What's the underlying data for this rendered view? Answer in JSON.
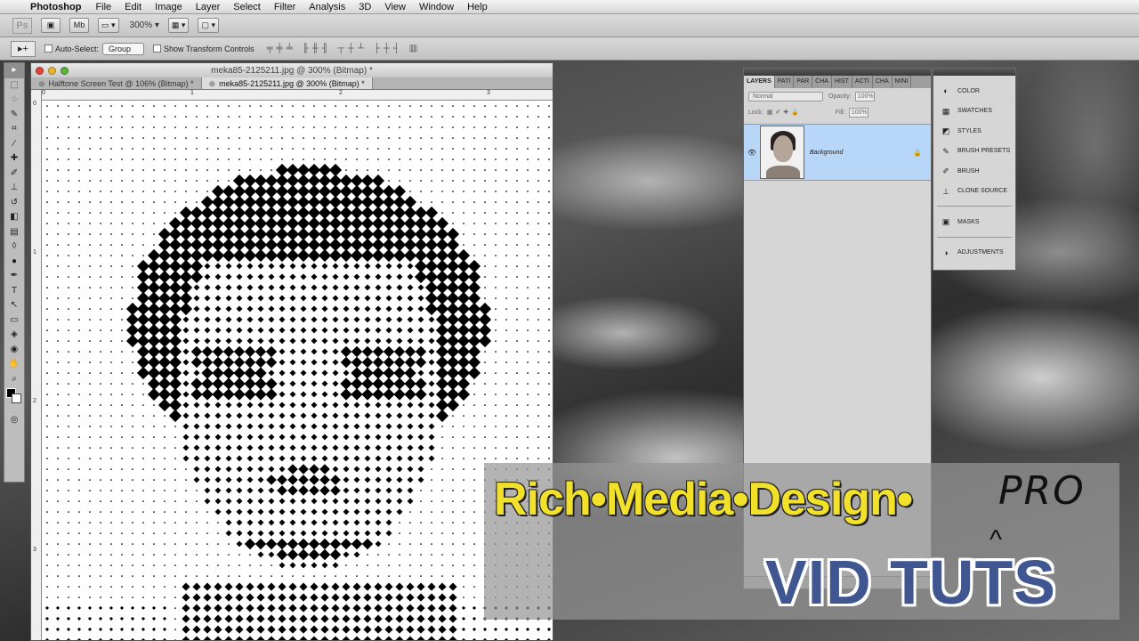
{
  "menubar": {
    "app_name": "Photoshop",
    "menus": [
      "File",
      "Edit",
      "Image",
      "Layer",
      "Select",
      "Filter",
      "Analysis",
      "3D",
      "View",
      "Window",
      "Help"
    ]
  },
  "appbar": {
    "logo": "Ps",
    "zoom": "300%"
  },
  "optionsbar": {
    "auto_select_label": "Auto-Select:",
    "auto_select_value": "Group",
    "transform_label": "Show Transform Controls"
  },
  "document": {
    "title": "meka85-2125211.jpg @ 300% (Bitmap) *",
    "tabs": [
      {
        "label": "Halftone Screen Test @ 106% (Bitmap) *",
        "active": false
      },
      {
        "label": "meka85-2125211.jpg @ 300% (Bitmap) *",
        "active": true
      }
    ],
    "ruler_h": [
      "0",
      "1",
      "2",
      "3"
    ],
    "ruler_v": [
      "0",
      "1",
      "2",
      "3"
    ]
  },
  "layers_panel": {
    "tabs": [
      "LAYERS",
      "PATI",
      "PAR",
      "CHA",
      "HIST",
      "ACTI",
      "CHA",
      "MINI"
    ],
    "blend_mode": "Normal",
    "opacity_label": "Opacity:",
    "opacity_value": "100%",
    "lock_label": "Lock:",
    "fill_label": "Fill:",
    "fill_value": "100%",
    "layer_name": "Background"
  },
  "dock": {
    "items": [
      {
        "label": "COLOR",
        "icon": "color-icon"
      },
      {
        "label": "SWATCHES",
        "icon": "swatches-icon"
      },
      {
        "label": "STYLES",
        "icon": "styles-icon"
      },
      {
        "label": "BRUSH PRESETS",
        "icon": "brush-presets-icon"
      },
      {
        "label": "BRUSH",
        "icon": "brush-icon"
      },
      {
        "label": "CLONE SOURCE",
        "icon": "clone-source-icon"
      },
      {
        "label": "MASKS",
        "icon": "masks-icon"
      },
      {
        "label": "ADJUSTMENTS",
        "icon": "adjustments-icon"
      }
    ]
  },
  "branding": {
    "title": "Rich•Media•Design•",
    "pro": "PRO",
    "subtitle": "VID TUTS",
    "title_color": "#f2e12a",
    "subtitle_color": "#3f5690"
  }
}
